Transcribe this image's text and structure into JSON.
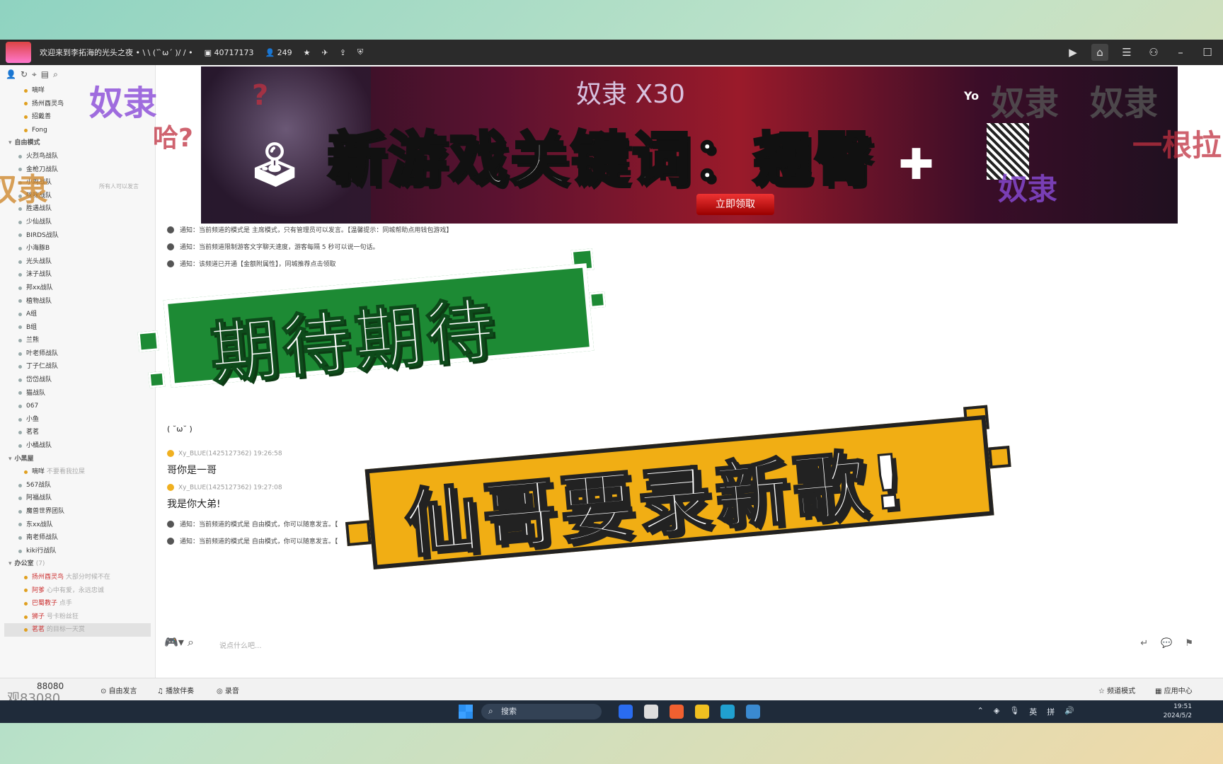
{
  "window": {
    "title": "欢迎来到李拓海的光头之夜 • \\ \\ (ˇ ̀ω´ )/ / •",
    "channel_id": "40717173",
    "online": "249"
  },
  "sidebar": {
    "top_member": "嘀咩",
    "members_top": [
      "扬州酉灵鸟",
      "招戴善",
      "Fong"
    ],
    "mode_label": "自由模式",
    "mode_note": "所有人可以发言",
    "groups": [
      "火烈鸟战队",
      "金枪刀战队",
      "小鸡战队",
      "咪咪战队",
      "胜遇战队",
      "少仙战队",
      "BIRDS战队",
      "小海豚B",
      "光头战队",
      "沫子战队",
      "邦xx战队",
      "植物战队",
      "A组",
      "B组",
      "兰熊",
      "叶老师战队",
      "丁子仁战队",
      "岱岱战队",
      "猫战队",
      "067",
      "小鱼",
      "茗茗",
      "小橘战队"
    ],
    "group2_label": "小黑屋",
    "group2_member": "嘀咩",
    "group2_member_note": "不要看我拉屎",
    "groups2": [
      "567战队",
      "阿福战队",
      "魔兽世界团队",
      "东xx战队",
      "南老师战队",
      "kiki行战队"
    ],
    "office_label": "办公室",
    "office_count": "(7)",
    "office_members": [
      {
        "name": "扬州酉灵鸟",
        "note": "大部分时候不在"
      },
      {
        "name": "阿爹",
        "note": "心中有爱，永远忠诚"
      },
      {
        "name": "巴蜀教子",
        "note": "点手"
      },
      {
        "name": "狮子",
        "note": "号卡粉丝狂"
      },
      {
        "name": "茗茗",
        "note": "的目标一天赏"
      }
    ]
  },
  "banner": {
    "x30": "奴隶 X30",
    "button": "立即领取",
    "brand": "Yo"
  },
  "danmaku": {
    "top_purple_1": "奴隶",
    "top_purple_2": "奴隶",
    "top_purple_3": "奴隶",
    "mid_purple": "奴隶",
    "left_purple": "奴隶",
    "red_right": "一根拉",
    "q1": "?",
    "q2": "哈?"
  },
  "chat": {
    "notices": [
      "通知：当前频道的模式是 主席模式，只有管理员可以发言。【温馨提示：同城帮助点用钱包游戏】",
      "通知：当前频道限制游客文字聊天速度，游客每隔 5 秒可以说一句话。",
      "通知：该频道已开通【金额附属性】，同城推荐点击领取",
      "通知：当前频道的模式是 自由模式，你可以随意发言。【",
      "通知：当前频道的模式是 自由模式，你可以随意发言。【"
    ],
    "emote": "( ˘ω˘ )",
    "messages": [
      {
        "user": "Xy_BLUE(1425127362)",
        "time": "19:26:58",
        "text": "哥你是一哥"
      },
      {
        "user": "Xy_BLUE(1425127362)",
        "time": "19:27:08",
        "text": "我是你大弟!"
      }
    ],
    "input_placeholder": "说点什么吧..."
  },
  "bottombar": {
    "count": "88080",
    "count2": "83080",
    "viewer_label": "观",
    "free_speak": "自由发言",
    "play_music": "播放伴奏",
    "record": "录音",
    "channel_mode": "频道模式",
    "app_center": "应用中心"
  },
  "taskbar": {
    "search": "搜索",
    "lang_1": "英",
    "lang_2": "拼",
    "time": "19:51",
    "date": "2024/5/2"
  },
  "overlay": {
    "title": "新游戏关键词：翘臀",
    "green": "期待期待",
    "yellow": "仙哥要录新歌!"
  }
}
